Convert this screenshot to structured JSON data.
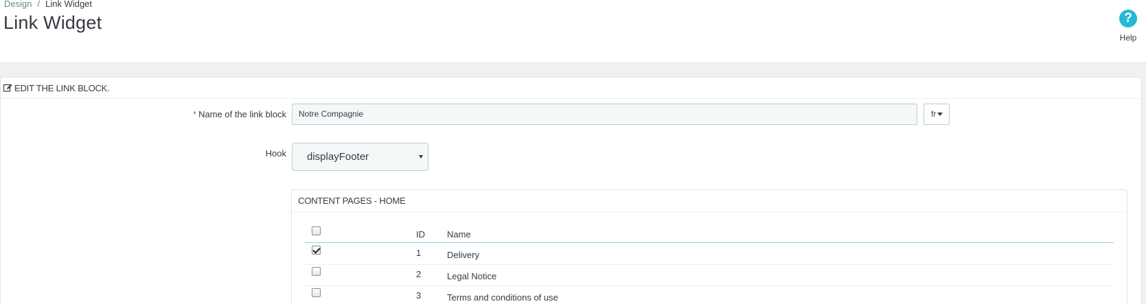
{
  "breadcrumb": {
    "parent": "Design",
    "separator": "/",
    "current": "Link Widget"
  },
  "page_title": "Link Widget",
  "help": {
    "icon": "question-circle-icon",
    "label": "Help"
  },
  "panel": {
    "heading": "Edit the link block.",
    "name_field": {
      "required_mark": "*",
      "label": "Name of the link block",
      "value": "Notre Compagnie",
      "language": "fr"
    },
    "hook_field": {
      "label": "Hook",
      "selected": "displayFooter"
    },
    "content_pages": {
      "heading": "Content pages - Home",
      "columns": {
        "id": "ID",
        "name": "Name"
      },
      "rows": [
        {
          "id": "1",
          "name": "Delivery",
          "checked": true
        },
        {
          "id": "2",
          "name": "Legal Notice",
          "checked": false
        },
        {
          "id": "3",
          "name": "Terms and conditions of use",
          "checked": false
        }
      ]
    }
  },
  "colors": {
    "accent": "#25b9d7",
    "required": "#c05c67",
    "border": "#bbcdd2",
    "background": "#eff1f2"
  }
}
